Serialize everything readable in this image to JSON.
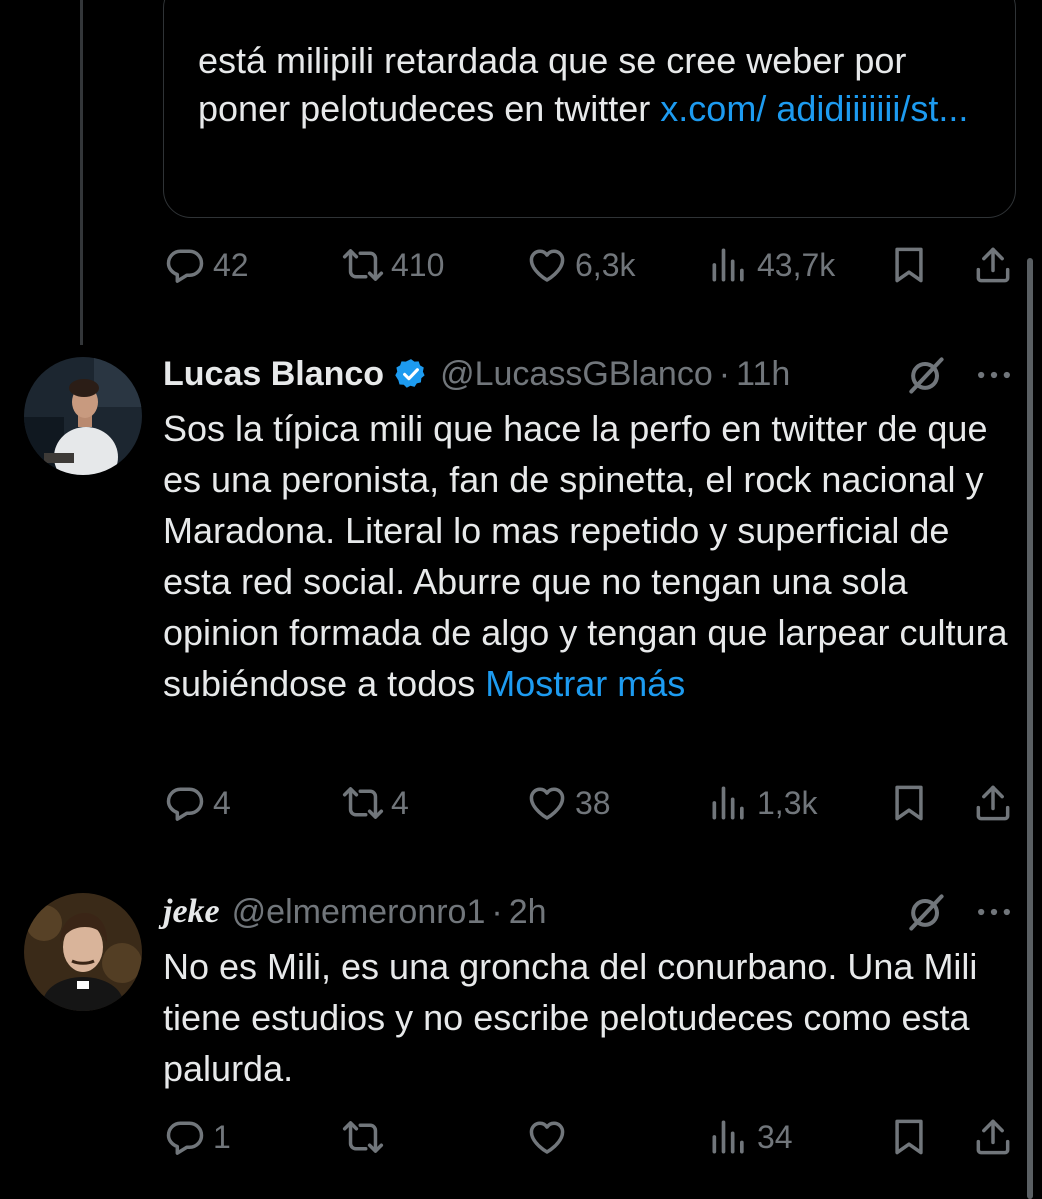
{
  "quoted": {
    "text": "está milipili retardada que se cree weber por poner pelotudeces en twitter ",
    "link_text": "x.com/ adidiiiiiii/st..."
  },
  "quoted_actions": {
    "replies": "42",
    "reposts": "410",
    "likes": "6,3k",
    "views": "43,7k"
  },
  "posts": [
    {
      "name": "Lucas Blanco",
      "handle": "@LucassGBlanco",
      "separator": "·",
      "time": "11h",
      "text": "Sos la típica mili que hace la perfo en twitter de que es una peronista, fan de spinetta, el rock nacional y Maradona. Literal lo mas repetido y superficial de esta red social. Aburre que no tengan una sola opinion formada de algo y tengan que larpear cultura subiéndose a todos ",
      "show_more": "Mostrar más",
      "actions": {
        "replies": "4",
        "reposts": "4",
        "likes": "38",
        "views": "1,3k"
      }
    },
    {
      "name": "jeke",
      "handle": "@elmemeronro1",
      "separator": "·",
      "time": "2h",
      "text": "No es Mili, es una groncha del conurbano. Una Mili tiene estudios y no escribe pelotudeces como esta palurda.",
      "actions": {
        "replies": "1",
        "reposts": "",
        "likes": "",
        "views": "34"
      }
    }
  ],
  "colors": {
    "background": "#000000",
    "text": "#e7e9ea",
    "muted": "#71767b",
    "link": "#1d9bf0",
    "verified": "#1d9bf0",
    "border": "#2f3336"
  },
  "icons": [
    "reply-icon",
    "repost-icon",
    "like-icon",
    "views-icon",
    "bookmark-icon",
    "share-icon",
    "grok-icon",
    "more-icon",
    "verified-icon"
  ]
}
